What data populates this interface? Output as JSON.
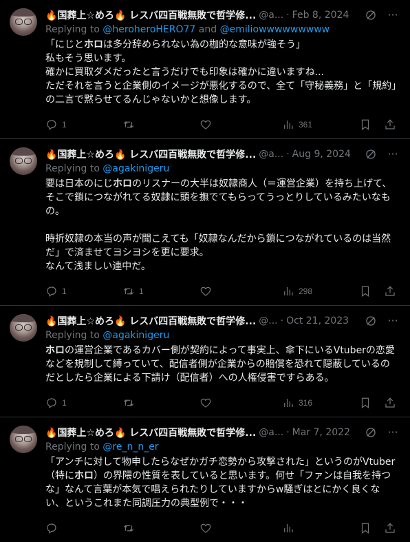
{
  "colors": {
    "background": "#000000",
    "text": "#e7e9ea",
    "muted": "#71767b",
    "link": "#1d9bf0",
    "divider": "#2f3336"
  },
  "tweets": [
    {
      "name": "国葬上☆めろ",
      "name_suffix": " レスバ四百戦無敗で哲学修...",
      "handle": "@a...",
      "date": "Feb 8, 2024",
      "replying_label": "Replying to ",
      "reply_to_1": "@heroheroHERO77",
      "reply_and": " and ",
      "reply_to_2": "@emiliowwwwwwwww",
      "body": "「にじとホロは多分辞められない為の枷的な意味が強そう」\n私もそう思います。\n確かに買取ダメだったと言うだけでも印象は確かに違いますね...\nただそれを言うと企業側のイメージが悪化するので、全て「守秘義務」と「規約」の二言で黙らせてるんじゃないかと想像します。",
      "replies": "1",
      "retweets": "",
      "likes": "",
      "views": "361"
    },
    {
      "name": "国葬上☆めろ",
      "name_suffix": " レスバ四百戦無敗で哲学修...",
      "handle": "@a...",
      "date": "Aug 9, 2024",
      "replying_label": "Replying to ",
      "reply_to_1": "@agakinigeru",
      "body": "要は日本のにじホロのリスナーの大半は奴隷商人（＝運営企業）を持ち上げて、そこで鎖につながれてる奴隷に頭を撫でてもらってうっとりしているみたいなもの。\n\n時折奴隷の本当の声が聞こえても「奴隷なんだから鎖につながれているのは当然だ」で済ませてヨシヨシを更に要求。\nなんて浅ましい連中だ。",
      "replies": "1",
      "retweets": "1",
      "likes": "",
      "views": "298"
    },
    {
      "name": "国葬上☆めろ",
      "name_suffix": " レスバ四百戦無敗で哲学修...",
      "handle": "@...",
      "date": "Oct 21, 2023",
      "replying_label": "Replying to ",
      "reply_to_1": "@agakinigeru",
      "body": "ホロの運営企業であるカバー側が契約によって事実上、傘下にいるVtuberの恋愛などを規制して縛っていて、配信者側が企業からの賠償を恐れて隠蔽しているのだとしたら企業による下請け（配信者）への人権侵害ですらある。",
      "replies": "1",
      "retweets": "",
      "likes": "",
      "views": "316"
    },
    {
      "name": "国葬上☆めろ",
      "name_suffix": " レスバ四百戦無敗で哲学修...",
      "handle": "@a...",
      "date": "Mar 7, 2022",
      "replying_label": "Replying to ",
      "reply_to_1": "@re_n_n_er",
      "body": "「アンチに対して物申したらなぜかガチ恋勢から攻撃された」というのがVtuber（特にホロ）の界隈の性質を表していると思います。何せ「ファンは自我を持つな」なんて言葉が本気で唱えられたりしていますからw騒ぎはとにかく良くない、というこれまた同調圧力の典型例で・・・",
      "replies": "",
      "retweets": "",
      "likes": "",
      "views": ""
    }
  ]
}
